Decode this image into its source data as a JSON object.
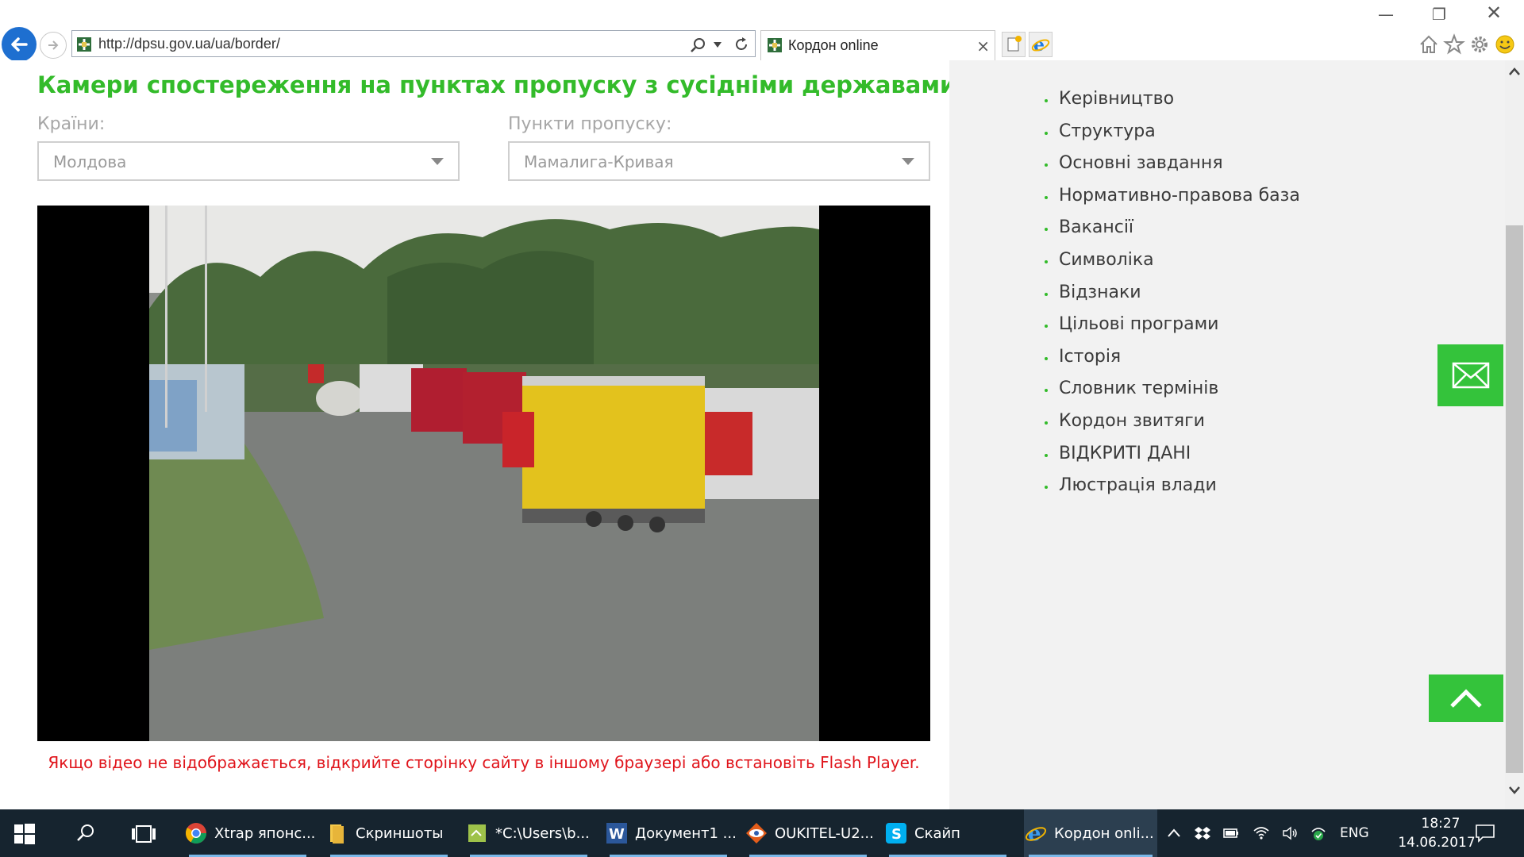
{
  "browser": {
    "url": "http://dpsu.gov.ua/ua/border/",
    "tab_title": "Кордон online",
    "tab_close": "×",
    "window_controls": {
      "minimize": "—",
      "restore": "❐",
      "close": "✕"
    },
    "toolbar_icons": [
      "home-icon",
      "favorites-star-icon",
      "gear-icon",
      "smiley-feedback-icon"
    ]
  },
  "page": {
    "title": "Камери спостереження на пунктах пропуску з сусідніми державами",
    "countries": {
      "label": "Країни:",
      "selected": "Молдова"
    },
    "checkpoints": {
      "label": "Пункти пропуску:",
      "selected": "Мамалига-Кривая"
    },
    "flash_notice": "Якщо відео не відображається, відкрийте сторінку сайту в іншому браузері або встановіть Flash Player."
  },
  "sidebar": {
    "items": [
      "Керівництво",
      "Структура",
      "Основні завдання",
      "Нормативно-правова база",
      "Вакансії",
      "Символіка",
      "Відзнаки",
      "Цільові програми",
      "Історія",
      "Словник термінів",
      "Кордон звитяги",
      "ВІДКРИТІ ДАНІ",
      "Люстрація влади"
    ]
  },
  "taskbar": {
    "items": [
      {
        "label": "Xtrap японс...",
        "icon": "chrome-icon"
      },
      {
        "label": "Скриншоты",
        "icon": "folder-icon"
      },
      {
        "label": "*C:\\Users\\b...",
        "icon": "notepad-icon"
      },
      {
        "label": "Документ1 ...",
        "icon": "word-icon"
      },
      {
        "label": "OUKITEL-U2...",
        "icon": "eye-app-icon"
      },
      {
        "label": "Скайп",
        "icon": "skype-icon"
      },
      {
        "label": "Кордон onli...",
        "icon": "ie-icon"
      }
    ],
    "language": "ENG",
    "time": "18:27",
    "date": "14.06.2017"
  },
  "colors": {
    "accent_green": "#33bb2a",
    "button_green": "#34c33b",
    "notice_red": "#e0141b",
    "taskbar": "#16242f",
    "sidebar_bg": "#f2f2f2",
    "ie_blue": "#1e6fd0"
  }
}
